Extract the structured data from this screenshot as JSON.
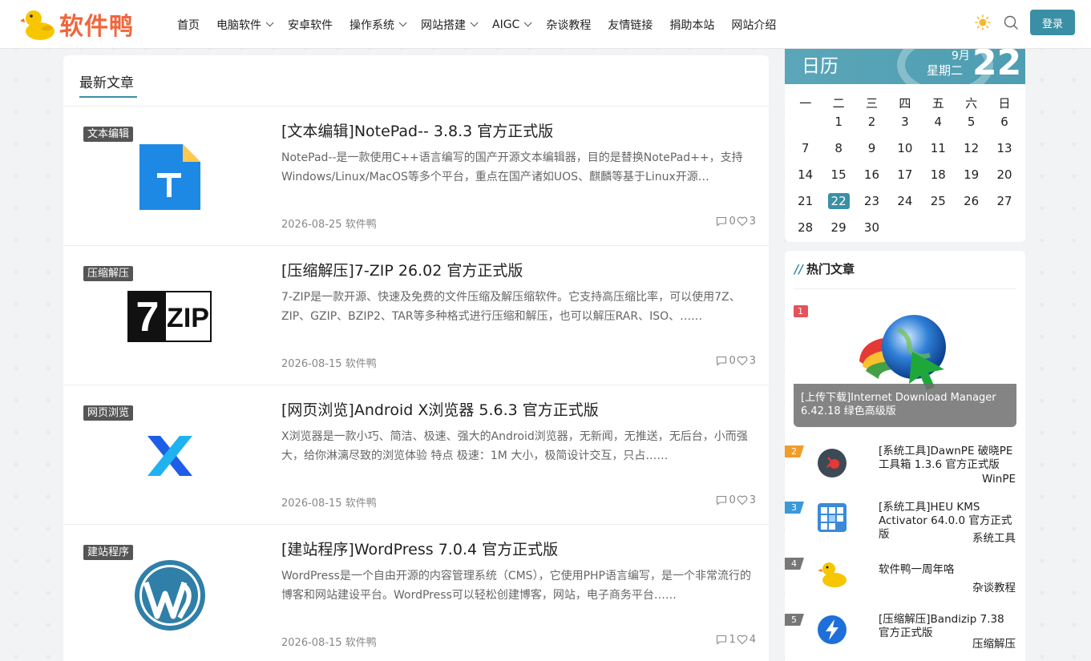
{
  "header": {
    "logo_text": "软件鸭",
    "nav": [
      {
        "label": "首页",
        "dropdown": false
      },
      {
        "label": "电脑软件",
        "dropdown": true
      },
      {
        "label": "安卓软件",
        "dropdown": false
      },
      {
        "label": "操作系统",
        "dropdown": true
      },
      {
        "label": "网站搭建",
        "dropdown": true
      },
      {
        "label": "AIGC",
        "dropdown": true
      },
      {
        "label": "杂谈教程",
        "dropdown": false
      },
      {
        "label": "友情链接",
        "dropdown": false
      },
      {
        "label": "捐助本站",
        "dropdown": false
      },
      {
        "label": "网站介绍",
        "dropdown": false
      }
    ],
    "login_label": "登录"
  },
  "main": {
    "title": "最新文章",
    "articles": [
      {
        "category": "文本编辑",
        "title": "[文本编辑]NotePad-- 3.8.3 官方正式版",
        "desc": "NotePad--是一款使用C++语言编写的国产开源文本编辑器，目的是替换NotePad++，支持Windows/Linux/MacOS等多个平台，重点在国产诸如UOS、麒麟等基于Linux开源…",
        "date": "2026-08-25",
        "author": "软件鸭",
        "comments": "0",
        "likes": "3",
        "icon": "notepad-icon"
      },
      {
        "category": "压缩解压",
        "title": "[压缩解压]7-ZIP 26.02 官方正式版",
        "desc": "7-ZIP是一款开源、快速及免费的文件压缩及解压缩软件。它支持高压缩比率，可以使用7Z、ZIP、GZIP、BZIP2、TAR等多种格式进行压缩和解压，也可以解压RAR、ISO、……",
        "date": "2026-08-15",
        "author": "软件鸭",
        "comments": "0",
        "likes": "3",
        "icon": "7zip-icon",
        "icon_text_a": "7",
        "icon_text_b": "ZIP"
      },
      {
        "category": "网页浏览",
        "title": "[网页浏览]Android X浏览器 5.6.3 官方正式版",
        "desc": "X浏览器是一款小巧、简洁、极速、强大的Android浏览器，无新闻，无推送，无后台，小而强大，给你淋漓尽致的浏览体验 特点 极速：1M 大小，极简设计交互，只占……",
        "date": "2026-08-15",
        "author": "软件鸭",
        "comments": "0",
        "likes": "3",
        "icon": "x-browser-icon"
      },
      {
        "category": "建站程序",
        "title": "[建站程序]WordPress 7.0.4 官方正式版",
        "desc": "WordPress是一个自由开源的内容管理系统（CMS），它使用PHP语言编写，是一个非常流行的博客和网站建设平台。WordPress可以轻松创建博客，网站，电子商务平台……",
        "date": "2026-08-15",
        "author": "软件鸭",
        "comments": "1",
        "likes": "4",
        "icon": "wordpress-icon"
      }
    ]
  },
  "calendar": {
    "label": "日历",
    "month": "9月",
    "weekday": "星期二",
    "day": "22",
    "week_headers": [
      "一",
      "二",
      "三",
      "四",
      "五",
      "六",
      "日"
    ],
    "rows": [
      [
        "",
        "1",
        "2",
        "3",
        "4",
        "5",
        "6"
      ],
      [
        "7",
        "8",
        "9",
        "10",
        "11",
        "12",
        "13"
      ],
      [
        "14",
        "15",
        "16",
        "17",
        "18",
        "19",
        "20"
      ],
      [
        "21",
        "22",
        "23",
        "24",
        "25",
        "26",
        "27"
      ],
      [
        "28",
        "29",
        "30",
        "",
        "",
        "",
        ""
      ]
    ],
    "today": "22"
  },
  "hot": {
    "title": "热门文章",
    "title_prefix": "//",
    "feature": {
      "rank": "1",
      "title": "[上传下载]Internet Download Manager 6.42.18 绿色高级版"
    },
    "items": [
      {
        "rank": "2",
        "title": "[系统工具]DawnPE 破晓PE 工具箱 1.3.6 官方正式版",
        "category": "WinPE",
        "color": "#f29c2b"
      },
      {
        "rank": "3",
        "title": "[系统工具]HEU KMS Activator 64.0.0 官方正式版",
        "category": "系统工具",
        "color": "#3a9ad9"
      },
      {
        "rank": "4",
        "title": "软件鸭一周年咯",
        "category": "杂谈教程",
        "color": "#777777"
      },
      {
        "rank": "5",
        "title": "[压缩解压]Bandizip 7.38 官方正式版",
        "category": "压缩解压",
        "color": "#777777"
      }
    ]
  },
  "colors": {
    "accent": "#3a8fa5",
    "logo": "#f0663c",
    "rank1": "#e8505b"
  }
}
